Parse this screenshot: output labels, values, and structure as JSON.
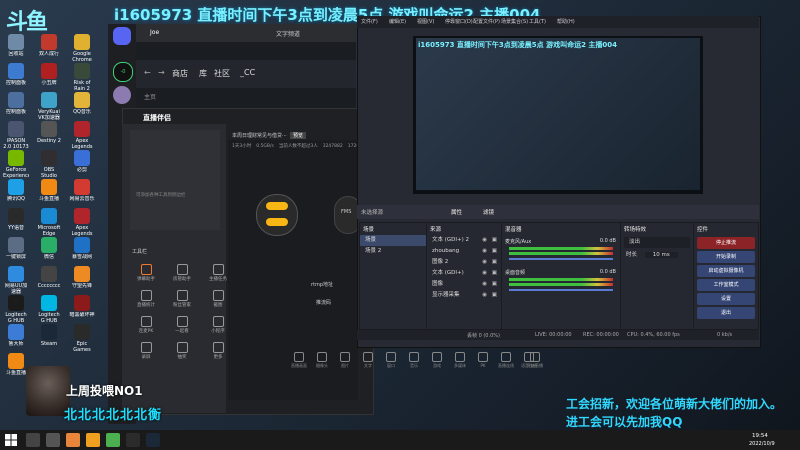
{
  "overlay": {
    "logo_text": "斗鱼",
    "stream_title": "i1605973  直播时间下午3点到凌晨5点  游戏叫命运2  主播004",
    "recruit_line1": "工会招新，欢迎各位萌新大佬们的加入。",
    "recruit_line2": "进工会可以先加我QQ",
    "ranking_label": "上周投喂NO1",
    "ranking_name": "北北北北北北衡"
  },
  "desktop_icons": [
    {
      "label": "回收站",
      "color": "#6f8aa6"
    },
    {
      "label": "双人成行",
      "color": "#c23a2b"
    },
    {
      "label": "Google Chrome",
      "color": "#e0b030"
    },
    {
      "label": "控制面板",
      "color": "#3d7bd1"
    },
    {
      "label": "小丑牌",
      "color": "#b02020"
    },
    {
      "label": "Risk of Rain 2",
      "color": "#3a4a3a"
    },
    {
      "label": "控制面板",
      "color": "#4d6fa0"
    },
    {
      "label": "VeryKuai VK加速器",
      "color": "#3fa3c9"
    },
    {
      "label": "QQ音乐",
      "color": "#e2b43a"
    },
    {
      "label": "iPASON 2.0 10173电竞",
      "color": "#4a5570"
    },
    {
      "label": "Destiny 2",
      "color": "#555"
    },
    {
      "label": "Apex Legends",
      "color": "#b0242c"
    },
    {
      "label": "GeForce Experience",
      "color": "#76b900"
    },
    {
      "label": "OBS Studio",
      "color": "#302e31"
    },
    {
      "label": "必剪",
      "color": "#3b6fd8"
    },
    {
      "label": "腾讯QQ",
      "color": "#1fa0e6"
    },
    {
      "label": "斗鱼直播",
      "color": "#f08a14"
    },
    {
      "label": "网易云音乐",
      "color": "#d33a31"
    },
    {
      "label": "YY语音",
      "color": "#2a2a2a"
    },
    {
      "label": "Microsoft Edge",
      "color": "#1a8ad4"
    },
    {
      "label": "Apex Legends",
      "color": "#b0242c"
    },
    {
      "label": "一键锁屏",
      "color": "#5b6c84"
    },
    {
      "label": "微信",
      "color": "#2aae67"
    },
    {
      "label": "暴雪战网",
      "color": "#1f71c6"
    },
    {
      "label": "网易UU加速器",
      "color": "#2e8bdf"
    },
    {
      "label": "Cccccccc",
      "color": "#444"
    },
    {
      "label": "守望先锋",
      "color": "#ee8a22"
    },
    {
      "label": "Logitech G HUB",
      "color": "#1b1b1b"
    },
    {
      "label": "Logitech G HUB",
      "color": "#00b7e3"
    },
    {
      "label": "暗黑破坏神",
      "color": "#8b1a1a"
    },
    {
      "label": "鲁大师",
      "color": "#3c7cd6"
    },
    {
      "label": "Steam",
      "color": "#1b2838"
    },
    {
      "label": "Epic Games Launcher",
      "color": "#2a2a2a"
    },
    {
      "label": "斗鱼直播",
      "color": "#f08a14"
    }
  ],
  "discord": {
    "channel_user": "Joe",
    "channel_text": "文字频道",
    "online_indicator": "-0"
  },
  "launcher": {
    "nav_items": [
      "商店",
      "库",
      "社区",
      "_CC"
    ],
    "home_label": "主页"
  },
  "douyu_app": {
    "title": "直播伴侣",
    "room_label": "本周日理财常见与借贷···",
    "room_btn": "预览",
    "status_items": [
      "1天3小时",
      "0.5GB/s",
      "当前人数不超过3人",
      "3247882",
      "17262"
    ],
    "side_title": "工具栏",
    "side_items": [
      "弹幕助手",
      "房管助手",
      "主播任务",
      "直播统计",
      "粉丝管家",
      "截图",
      "连麦PK",
      "一起看",
      "小程序",
      "录屏",
      "抽奖",
      "更多"
    ],
    "side_hint": "可添加各种工具到侧边栏",
    "rtmp_label": "rtmp地址",
    "key_label": "推流码",
    "fms_label": "FMS",
    "bottom_labels": [
      "直播画面",
      "摄像头",
      "图片",
      "文字",
      "窗口",
      "音乐",
      "游戏",
      "多媒体",
      "PK",
      "直播连线",
      "语音连线",
      "开始直播"
    ]
  },
  "obs": {
    "menu_items": [
      "文件(F)",
      "编辑(E)",
      "视图(V)",
      "停靠窗口(D)",
      "配置文件(P)",
      "场景集合(S)",
      "工具(T)",
      "帮助(H)"
    ],
    "preview_title": "i1605973 直播时间下午3点到凌晨5点 游戏叫命运2 主播004",
    "toolbar_source": "未选择源",
    "toolbar_props": "属性",
    "toolbar_filters": "滤镜",
    "docks": {
      "scenes_title": "场景",
      "scenes": [
        "场景",
        "场景 2"
      ],
      "sources_title": "来源",
      "sources": [
        "文本 (GDI+) 2",
        "zhoubang",
        "图像 2",
        "文本 (GDI+)",
        "图像",
        "显示器采集"
      ],
      "mixer_title": "混音器",
      "mixer": [
        {
          "name": "麦克风/Aux",
          "db": "0.0 dB"
        },
        {
          "name": "桌面音频",
          "db": "0.0 dB"
        }
      ],
      "transitions_title": "转场特效",
      "transition_type": "淡出",
      "duration_label": "时长",
      "duration_value": "10 ms",
      "controls_title": "控件",
      "controls": [
        "停止推流",
        "开始录制",
        "启动虚拟摄像机",
        "工作室模式",
        "设置",
        "退出"
      ]
    },
    "status": {
      "dropped": "丢帧 0 (0.0%)",
      "live": "LIVE: 00:00:00",
      "rec": "REC: 00:00:00",
      "cpu": "CPU: 0.4%, 60.00 fps",
      "bitrate": "0 kb/s"
    }
  },
  "taskbar": {
    "clock_time": "19:54",
    "clock_date": "2022/10/9",
    "apps": [
      {
        "name": "search",
        "color": "#444"
      },
      {
        "name": "obs",
        "color": "#555"
      },
      {
        "name": "orange-app",
        "color": "#e8853a"
      },
      {
        "name": "douyu",
        "color": "#f0a020"
      },
      {
        "name": "green-app",
        "color": "#4caf50"
      },
      {
        "name": "dark-app",
        "color": "#2b2b2b"
      },
      {
        "name": "steam",
        "color": "#1b2838"
      }
    ]
  }
}
